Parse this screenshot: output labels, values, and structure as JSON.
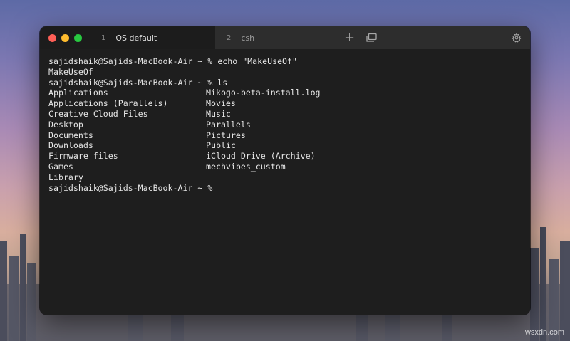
{
  "tabs": [
    {
      "number": "1",
      "name": "OS default"
    },
    {
      "number": "2",
      "name": "csh"
    }
  ],
  "terminal": {
    "lines_before": [
      "sajidshaik@Sajids-MacBook-Air ~ % echo \"MakeUseOf\"",
      "MakeUseOf",
      "sajidshaik@Sajids-MacBook-Air ~ % ls"
    ],
    "ls_rows": [
      [
        "Applications",
        "Mikogo-beta-install.log"
      ],
      [
        "Applications (Parallels)",
        "Movies"
      ],
      [
        "Creative Cloud Files",
        "Music"
      ],
      [
        "Desktop",
        "Parallels"
      ],
      [
        "Documents",
        "Pictures"
      ],
      [
        "Downloads",
        "Public"
      ],
      [
        "Firmware files",
        "iCloud Drive (Archive)"
      ],
      [
        "Games",
        "mechvibes_custom"
      ],
      [
        "Library",
        ""
      ]
    ],
    "prompt_after": "sajidshaik@Sajids-MacBook-Air ~ %"
  },
  "icons": {
    "close": "close-dot",
    "minimize": "minimize-dot",
    "maximize": "maximize-dot",
    "new_tab": "plus-icon",
    "new_window": "window-stack-icon",
    "settings": "gear-icon"
  },
  "colors": {
    "close": "#ff5f57",
    "minimize": "#febc2e",
    "maximize": "#28c840",
    "terminal_bg": "#1e1e1e",
    "terminal_fg": "#e6e6e6"
  },
  "watermark": "wsxdn.com"
}
